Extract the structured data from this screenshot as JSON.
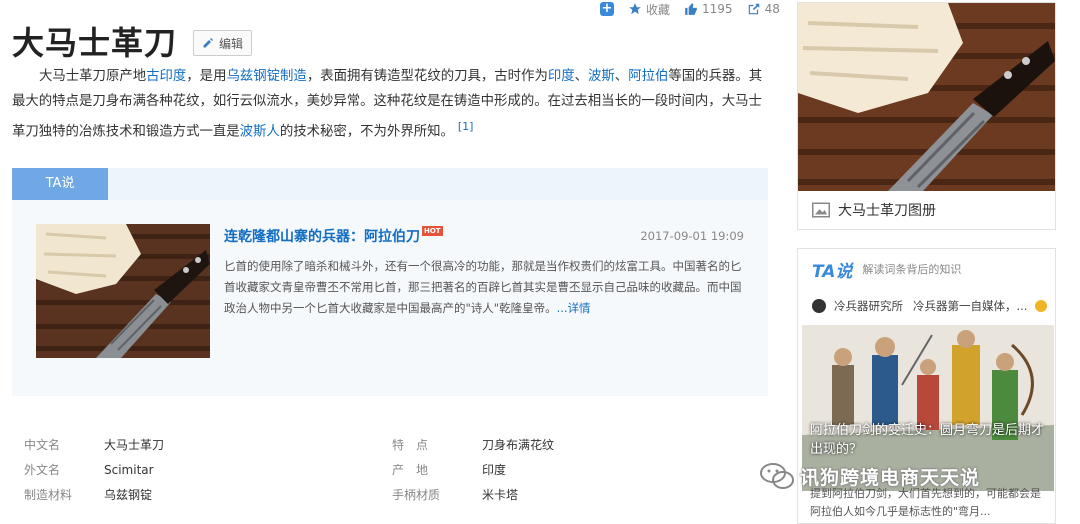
{
  "actions": {
    "favorite_label": "收藏",
    "like_count": "1195",
    "share_count": "48"
  },
  "title": "大马士革刀",
  "edit_label": "编辑",
  "summary": {
    "p1": "大马士革刀原产地",
    "l1": "古印度",
    "p2": "，是用",
    "l2": "乌兹钢锭",
    "l3": "制造",
    "p3": "，表面拥有铸造型花纹的刀具，古时作为",
    "l4": "印度",
    "p4": "、",
    "l5": "波斯",
    "p5": "、",
    "l6": "阿拉伯",
    "p6": "等国的兵器。其最大的特点是刀身布满各种花纹，如行云似流水，美妙异常。这种花纹是在铸造中形成的。在过去相当长的一段时间内，大马士革刀独特的冶炼技术和锻造方式一直是",
    "l7": "波斯人",
    "p7": "的技术秘密，不为外界所知。",
    "ref": "[1]"
  },
  "ta_tab": "TA说",
  "ta_card": {
    "headline": "连乾隆都山寨的兵器：阿拉伯刀",
    "hot": "HOT",
    "date": "2017-09-01 19:09",
    "body": "匕首的使用除了暗杀和械斗外，还有一个很高冷的功能，那就是当作权贵们的炫富工具。中国著名的匕首收藏家文青皇帝曹丕不常用匕首，那三把著名的百辟匕首其实是曹丕显示自己品味的收藏品。而中国政治人物中另一个匕首大收藏家是中国最高产的\"诗人\"乾隆皇帝。",
    "more": "...详情"
  },
  "info": [
    {
      "k1": "中文名",
      "v1": "大马士革刀",
      "k2": "特　点",
      "v2": "刀身布满花纹"
    },
    {
      "k1": "外文名",
      "v1": "Scimitar",
      "k2": "产　地",
      "v2": "印度"
    },
    {
      "k1": "制造材料",
      "v1": "乌兹钢锭",
      "k2": "手柄材质",
      "v2": "米卡塔"
    }
  ],
  "album_label": "大马士革刀图册",
  "tabox": {
    "logo": "TA说",
    "subtitle": "解读词条背后的知识",
    "author": "冷兵器研究所",
    "author_desc": "冷兵器第一自媒体，...",
    "caption": "阿拉伯刀剑的变迁史：圆月弯刀是后期才出现的？",
    "excerpt": "提到阿拉伯刀剑，大们首先想到的，可能都会是阿拉伯人如今几乎是标志性的\"弯月..."
  },
  "watermark": "讯狗跨境电商天天说",
  "colors": {
    "link": "#136ec2",
    "tab_accent": "#6fa8e4",
    "hot_badge": "#e5533a"
  }
}
